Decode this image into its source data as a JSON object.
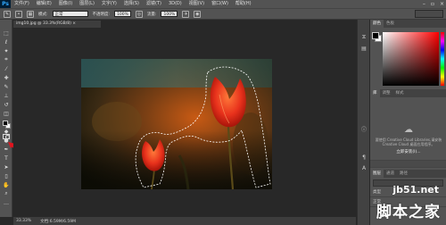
{
  "app": {
    "logo": "Ps"
  },
  "menu": [
    "文件(F)",
    "编辑(E)",
    "图像(I)",
    "图层(L)",
    "文字(Y)",
    "选择(S)",
    "滤镜(T)",
    "3D(D)",
    "视图(V)",
    "窗口(W)",
    "帮助(H)"
  ],
  "window_controls": [
    "–",
    "▫",
    "×"
  ],
  "options": {
    "mode_label": "模式:",
    "mode_value": "正常",
    "opacity_label": "不透明度:",
    "opacity_value": "100%",
    "flow_label": "流量:",
    "flow_value": "100%"
  },
  "document": {
    "tab_title": "img10.jpg @ 33.3%(RGB/8) ×"
  },
  "status": {
    "zoom": "33.33%",
    "doc_size": "文档:6.59M/6.59M"
  },
  "panels": {
    "color_tabs": [
      "颜色",
      "色板"
    ],
    "library_tabs": [
      "库",
      "调整",
      "样式"
    ],
    "library_message": "要使用 Creative Cloud Libraries,请安装 Creative Cloud 桌面应用程序。",
    "library_link": "立即安装(I)...",
    "layers_tabs": [
      "图层",
      "通道",
      "路径"
    ],
    "layer_kind": "类型",
    "layer_mode": "正常"
  },
  "colors": {
    "accent_arrow": "#e0141e",
    "ps_blue": "#31a8ff"
  },
  "watermark": {
    "url": "jb51.net",
    "name": "脚本之家"
  }
}
